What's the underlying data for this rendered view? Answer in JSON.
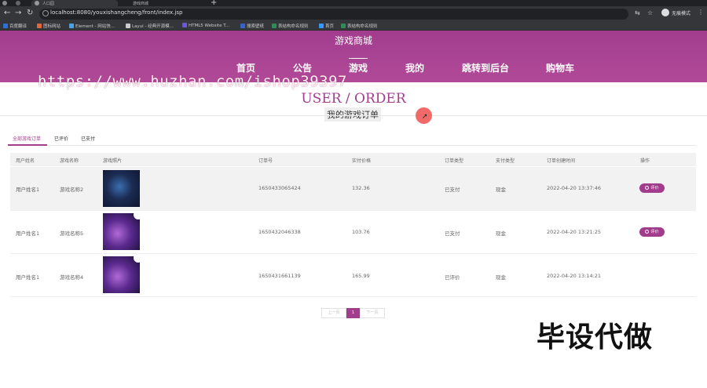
{
  "browser": {
    "tabs": [
      {
        "title": "人口园"
      },
      {
        "title": "游戏商城"
      }
    ],
    "url": "localhost:8080/youxishangcheng/front/index.jsp",
    "profile_label": "无痕模式",
    "bookmarks": [
      {
        "label": "百度翻译",
        "color": "#2f6fd6"
      },
      {
        "label": "图标网站",
        "color": "#e2673a"
      },
      {
        "label": "Element - 网站快...",
        "color": "#4aa3e0"
      },
      {
        "label": "Layui - 经典开源模...",
        "color": "#cccccc"
      },
      {
        "label": "HTML5 Website T...",
        "color": "#6a5acd"
      },
      {
        "label": "搜索壁纸",
        "color": "#3366cc"
      },
      {
        "label": "表结构命名规则",
        "color": "#2e8b57"
      },
      {
        "label": "首页",
        "color": "#3399ff"
      },
      {
        "label": "表结构命名规则",
        "color": "#2e8b57"
      }
    ]
  },
  "site": {
    "title": "游戏商城",
    "nav": [
      "首页",
      "公告",
      "游戏",
      "我的",
      "跳转到后台",
      "购物车"
    ],
    "active_nav": "游戏",
    "watermark_url": "https://www.huzhan.com/ishop39397",
    "section_title": "USER / ORDER",
    "section_subtitle": "我的游戏订单",
    "accent_color": "#a23c8d"
  },
  "order_tabs": [
    "全部游戏订单",
    "已评价",
    "已支付"
  ],
  "table": {
    "headers": [
      "用户姓名",
      "游戏名称",
      "游戏照片",
      "订单号",
      "实付价格",
      "订单类型",
      "支付类型",
      "订单创建时间",
      "操作"
    ],
    "rows": [
      {
        "user": "用户姓名1",
        "game": "游戏名称2",
        "image": "blue-game-art",
        "order_no": "1650433065424",
        "price": "132.36",
        "status": "已支付",
        "pay_type": "现金",
        "created": "2022-04-20 13:37:46",
        "action": "评价"
      },
      {
        "user": "用户姓名1",
        "game": "游戏名称5",
        "image": "purple-game-art",
        "order_no": "1650432046338",
        "price": "103.76",
        "status": "已支付",
        "pay_type": "现金",
        "created": "2022-04-20 13:21:25",
        "action": "评价"
      },
      {
        "user": "用户姓名1",
        "game": "游戏名称4",
        "image": "purple-game-art",
        "order_no": "1650431661139",
        "price": "165.99",
        "status": "已评价",
        "pay_type": "现金",
        "created": "2022-04-20 13:14:21",
        "action": ""
      }
    ]
  },
  "pagination": {
    "prev": "上一页",
    "current": "1",
    "next": "下一页"
  },
  "overlay_text": "毕设代做"
}
